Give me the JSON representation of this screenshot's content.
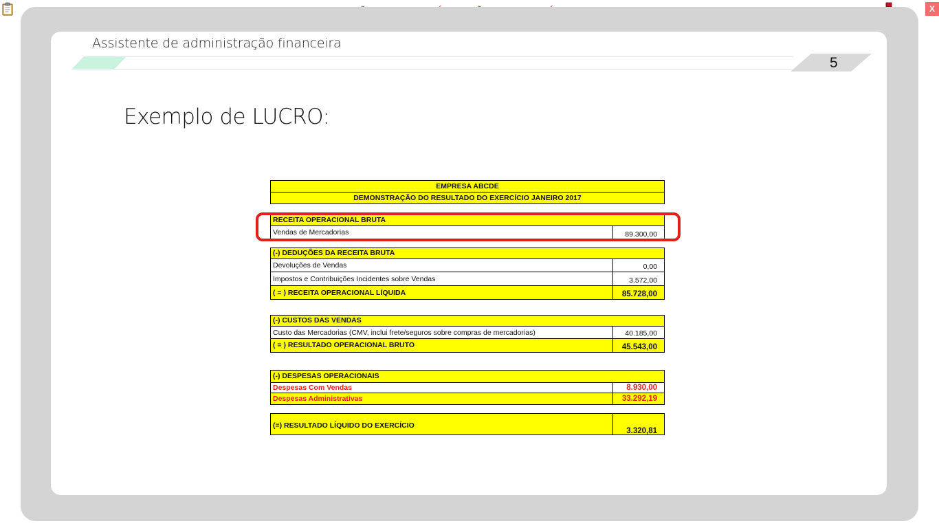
{
  "banner": "VERSÃO PARA FUNCIONÁRIOS - NÃO COMERCIALIZÁVEL",
  "close_label": "X",
  "icons": {
    "clipboard": "clipboard-icon",
    "network": "network-icon"
  },
  "header": {
    "title": "Assistente de administração financeira",
    "page_number": "5"
  },
  "slide": {
    "title": "Exemplo de LUCRO:"
  },
  "dre": {
    "company": "EMPRESA ABCDE",
    "statement_title": "DEMONSTRAÇÃO DO RESULTADO DO EXERCÍCIO JANEIRO 2017",
    "rows": [
      {
        "label": "RECEITA OPERACIONAL BRUTA",
        "value": ""
      },
      {
        "label": "Vendas de Mercadorias",
        "value": "89.300,00"
      },
      {
        "label": "(-) DEDUÇÕES DA RECEITA BRUTA",
        "value": ""
      },
      {
        "label": "Devoluções de Vendas",
        "value": "0,00"
      },
      {
        "label": "Impostos e Contribuições Incidentes sobre Vendas",
        "value": "3.572,00"
      },
      {
        "label": "( = ) RECEITA OPERACIONAL LÍQUIDA",
        "value": "85.728,00"
      },
      {
        "label": "(-) CUSTOS DAS VENDAS",
        "value": ""
      },
      {
        "label": "Custo das Mercadorias  (CMV, inclui frete/seguros sobre compras de mercadorias)",
        "value": "40.185,00"
      },
      {
        "label": "( = ) RESULTADO OPERACIONAL BRUTO",
        "value": "45.543,00"
      },
      {
        "label": "(-) DESPESAS OPERACIONAIS",
        "value": ""
      },
      {
        "label": "Despesas Com Vendas",
        "value": "8.930,00"
      },
      {
        "label": "Despesas Administrativas",
        "value": "33.292,19"
      },
      {
        "label": "(=) RESULTADO LÍQUIDO DO EXERCÍCIO",
        "value": "3.320,81"
      }
    ]
  },
  "colors": {
    "accent_red": "#e0201b",
    "highlight_yellow": "#ffff00",
    "banner_red": "#e8452f",
    "header_mint": "#c9f2df"
  }
}
